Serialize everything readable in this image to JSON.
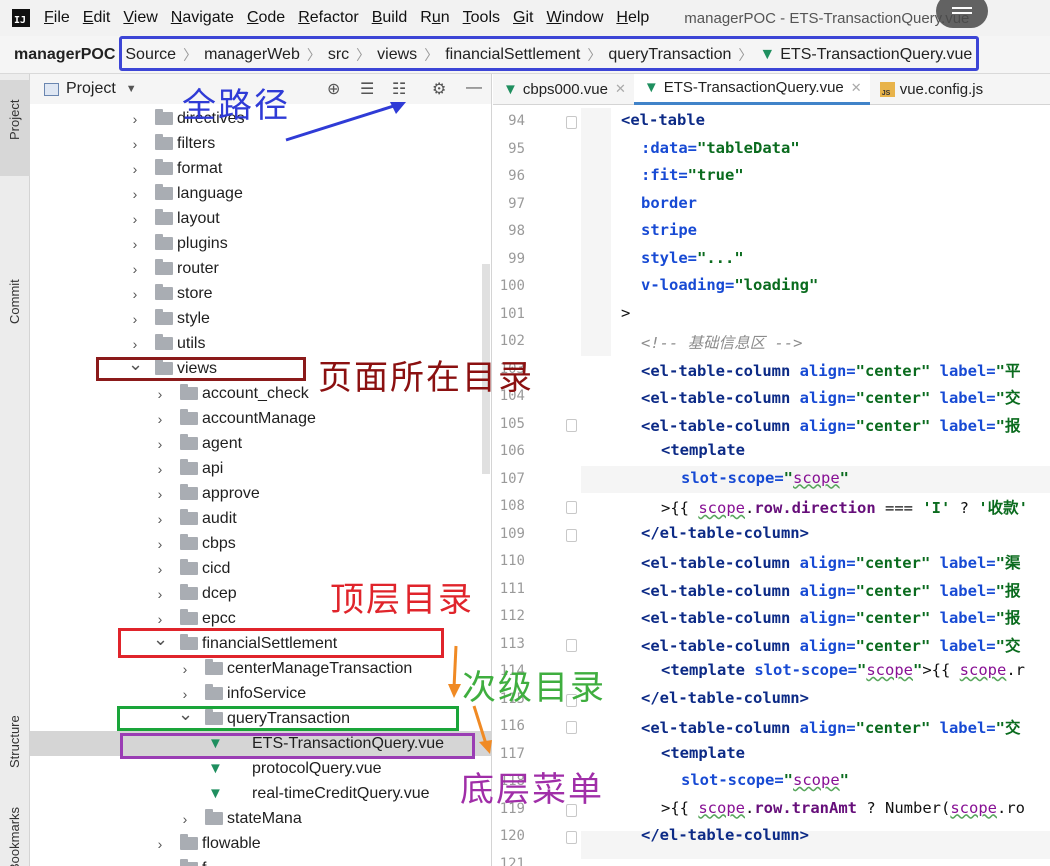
{
  "menubar": {
    "items": [
      {
        "underline": "F",
        "rest": "ile"
      },
      {
        "underline": "E",
        "rest": "dit"
      },
      {
        "underline": "V",
        "rest": "iew"
      },
      {
        "underline": "N",
        "rest": "avigate"
      },
      {
        "underline": "C",
        "rest": "ode"
      },
      {
        "underline": "R",
        "rest": "efactor"
      },
      {
        "underline": "B",
        "rest": "uild"
      },
      {
        "pre": "R",
        "underline": "u",
        "rest": "n"
      },
      {
        "underline": "T",
        "rest": "ools"
      },
      {
        "underline": "G",
        "rest": "it"
      },
      {
        "underline": "W",
        "rest": "indow"
      },
      {
        "underline": "H",
        "rest": "elp"
      }
    ],
    "window_title": "managerPOC - ETS-TransactionQuery.vue"
  },
  "navbar": {
    "project": "managerPOC",
    "crumbs": [
      "Source",
      "managerWeb",
      "src",
      "views",
      "financialSettlement",
      "queryTransaction",
      "ETS-TransactionQuery.vue"
    ]
  },
  "sidebar": {
    "project_tab": "Project",
    "commit_tab": "Commit",
    "structure_tab": "Structure",
    "bookmarks_tab": "Bookmarks"
  },
  "project_panel": {
    "header": "Project",
    "tree": [
      {
        "label": "directives",
        "level": 0,
        "type": "folder",
        "state": "collapsed"
      },
      {
        "label": "filters",
        "level": 0,
        "type": "folder",
        "state": "collapsed"
      },
      {
        "label": "format",
        "level": 0,
        "type": "folder",
        "state": "collapsed"
      },
      {
        "label": "language",
        "level": 0,
        "type": "folder",
        "state": "collapsed"
      },
      {
        "label": "layout",
        "level": 0,
        "type": "folder",
        "state": "collapsed"
      },
      {
        "label": "plugins",
        "level": 0,
        "type": "folder",
        "state": "collapsed"
      },
      {
        "label": "router",
        "level": 0,
        "type": "folder",
        "state": "collapsed"
      },
      {
        "label": "store",
        "level": 0,
        "type": "folder",
        "state": "collapsed"
      },
      {
        "label": "style",
        "level": 0,
        "type": "folder",
        "state": "collapsed"
      },
      {
        "label": "utils",
        "level": 0,
        "type": "folder",
        "state": "collapsed"
      },
      {
        "label": "views",
        "level": 0,
        "type": "folder",
        "state": "expanded"
      },
      {
        "label": "account_check",
        "level": 1,
        "type": "folder",
        "state": "collapsed"
      },
      {
        "label": "accountManage",
        "level": 1,
        "type": "folder",
        "state": "collapsed"
      },
      {
        "label": "agent",
        "level": 1,
        "type": "folder",
        "state": "collapsed"
      },
      {
        "label": "api",
        "level": 1,
        "type": "folder",
        "state": "collapsed"
      },
      {
        "label": "approve",
        "level": 1,
        "type": "folder",
        "state": "collapsed"
      },
      {
        "label": "audit",
        "level": 1,
        "type": "folder",
        "state": "collapsed"
      },
      {
        "label": "cbps",
        "level": 1,
        "type": "folder",
        "state": "collapsed"
      },
      {
        "label": "cicd",
        "level": 1,
        "type": "folder",
        "state": "collapsed"
      },
      {
        "label": "dcep",
        "level": 1,
        "type": "folder",
        "state": "collapsed"
      },
      {
        "label": "epcc",
        "level": 1,
        "type": "folder",
        "state": "collapsed"
      },
      {
        "label": "financialSettlement",
        "level": 1,
        "type": "folder",
        "state": "expanded"
      },
      {
        "label": "centerManageTransaction",
        "level": 2,
        "type": "folder",
        "state": "collapsed"
      },
      {
        "label": "infoService",
        "level": 2,
        "type": "folder",
        "state": "collapsed"
      },
      {
        "label": "queryTransaction",
        "level": 2,
        "type": "folder",
        "state": "expanded"
      },
      {
        "label": "ETS-TransactionQuery.vue",
        "level": 3,
        "type": "vue",
        "state": "selected"
      },
      {
        "label": "protocolQuery.vue",
        "level": 3,
        "type": "vue",
        "state": "none"
      },
      {
        "label": "real-timeCreditQuery.vue",
        "level": 3,
        "type": "vue",
        "state": "none"
      },
      {
        "label": "stateMana",
        "level": 2,
        "type": "folder",
        "state": "collapsed"
      },
      {
        "label": "flowable",
        "level": 1,
        "type": "folder",
        "state": "collapsed"
      },
      {
        "label": "f",
        "level": 1,
        "type": "folder",
        "state": "collapsed"
      }
    ]
  },
  "editor": {
    "tabs": [
      {
        "label": "cbps000.vue",
        "icon": "vue-icon",
        "active": false
      },
      {
        "label": "ETS-TransactionQuery.vue",
        "icon": "vue-icon",
        "active": true
      },
      {
        "label": "vue.config.js",
        "icon": "js-file-icon",
        "active": false
      }
    ],
    "lines": [
      {
        "n": "94",
        "indent": 2,
        "fold": true,
        "segs": [
          [
            "tg",
            "<el-table"
          ]
        ]
      },
      {
        "n": "95",
        "indent": 3,
        "segs": [
          [
            "at",
            ":data="
          ],
          [
            "sv",
            "\"tableData\""
          ]
        ]
      },
      {
        "n": "96",
        "indent": 3,
        "segs": [
          [
            "at",
            ":fit="
          ],
          [
            "sv",
            "\"true\""
          ]
        ]
      },
      {
        "n": "97",
        "indent": 3,
        "segs": [
          [
            "at",
            "border"
          ]
        ]
      },
      {
        "n": "98",
        "indent": 3,
        "segs": [
          [
            "at",
            "stripe"
          ]
        ]
      },
      {
        "n": "99",
        "indent": 3,
        "segs": [
          [
            "at",
            "style="
          ],
          [
            "sv",
            "\"...\""
          ]
        ]
      },
      {
        "n": "100",
        "indent": 3,
        "segs": [
          [
            "at",
            "v-loading="
          ],
          [
            "sv",
            "\"loading\""
          ]
        ]
      },
      {
        "n": "101",
        "indent": 2,
        "segs": [
          [
            "tx",
            ">"
          ]
        ]
      },
      {
        "n": "102",
        "indent": 3,
        "segs": [
          [
            "cm",
            "<!-- 基础信息区 -->"
          ]
        ]
      },
      {
        "n": "103",
        "indent": 3,
        "segs": [
          [
            "tg",
            "<el-table-column "
          ],
          [
            "at",
            "align="
          ],
          [
            "sv",
            "\"center\" "
          ],
          [
            "at",
            "label="
          ],
          [
            "sv",
            "\"平"
          ]
        ]
      },
      {
        "n": "104",
        "indent": 3,
        "segs": [
          [
            "tg",
            "<el-table-column "
          ],
          [
            "at",
            "align="
          ],
          [
            "sv",
            "\"center\" "
          ],
          [
            "at",
            "label="
          ],
          [
            "sv",
            "\"交"
          ]
        ]
      },
      {
        "n": "105",
        "indent": 3,
        "fold": true,
        "segs": [
          [
            "tg",
            "<el-table-column "
          ],
          [
            "at",
            "align="
          ],
          [
            "sv",
            "\"center\" "
          ],
          [
            "at",
            "label="
          ],
          [
            "sv",
            "\"报"
          ]
        ]
      },
      {
        "n": "106",
        "indent": 4,
        "segs": [
          [
            "tg",
            "<template"
          ]
        ]
      },
      {
        "n": "107",
        "indent": 5,
        "segs": [
          [
            "at",
            "slot-scope="
          ],
          [
            "sv",
            "\""
          ],
          [
            "sc",
            "scope"
          ],
          [
            "sv",
            "\""
          ]
        ]
      },
      {
        "n": "108",
        "indent": 4,
        "fold": true,
        "segs": [
          [
            "tx",
            ">{{ "
          ],
          [
            "sc",
            "scope"
          ],
          [
            "tx",
            "."
          ],
          [
            "pr",
            "row.direction"
          ],
          [
            "tx",
            " === "
          ],
          [
            "sv",
            "'I'"
          ],
          [
            "tx",
            " ? "
          ],
          [
            "sv",
            "'收款'"
          ]
        ]
      },
      {
        "n": "109",
        "indent": 3,
        "fold": true,
        "segs": [
          [
            "tg",
            "</el-table-column>"
          ]
        ]
      },
      {
        "n": "110",
        "indent": 3,
        "segs": [
          [
            "tg",
            "<el-table-column "
          ],
          [
            "at",
            "align="
          ],
          [
            "sv",
            "\"center\" "
          ],
          [
            "at",
            "label="
          ],
          [
            "sv",
            "\"渠"
          ]
        ]
      },
      {
        "n": "111",
        "indent": 3,
        "segs": [
          [
            "tg",
            "<el-table-column "
          ],
          [
            "at",
            "align="
          ],
          [
            "sv",
            "\"center\" "
          ],
          [
            "at",
            "label="
          ],
          [
            "sv",
            "\"报"
          ]
        ]
      },
      {
        "n": "112",
        "indent": 3,
        "segs": [
          [
            "tg",
            "<el-table-column "
          ],
          [
            "at",
            "align="
          ],
          [
            "sv",
            "\"center\" "
          ],
          [
            "at",
            "label="
          ],
          [
            "sv",
            "\"报"
          ]
        ]
      },
      {
        "n": "113",
        "indent": 3,
        "fold": true,
        "segs": [
          [
            "tg",
            "<el-table-column "
          ],
          [
            "at",
            "align="
          ],
          [
            "sv",
            "\"center\" "
          ],
          [
            "at",
            "label="
          ],
          [
            "sv",
            "\"交"
          ]
        ]
      },
      {
        "n": "114",
        "indent": 4,
        "segs": [
          [
            "tg",
            "<template "
          ],
          [
            "at",
            "slot-scope="
          ],
          [
            "sv",
            "\""
          ],
          [
            "sc",
            "scope"
          ],
          [
            "sv",
            "\""
          ],
          [
            "tx",
            ">{{ "
          ],
          [
            "sc",
            "scope"
          ],
          [
            "tx",
            ".r"
          ]
        ]
      },
      {
        "n": "115",
        "indent": 3,
        "fold": true,
        "segs": [
          [
            "tg",
            "</el-table-column>"
          ]
        ]
      },
      {
        "n": "116",
        "indent": 3,
        "fold": true,
        "segs": [
          [
            "tg",
            "<el-table-column "
          ],
          [
            "at",
            "align="
          ],
          [
            "sv",
            "\"center\" "
          ],
          [
            "at",
            "label="
          ],
          [
            "sv",
            "\"交"
          ]
        ]
      },
      {
        "n": "117",
        "indent": 4,
        "segs": [
          [
            "tg",
            "<template"
          ]
        ]
      },
      {
        "n": "118",
        "indent": 5,
        "segs": [
          [
            "at",
            "slot-scope="
          ],
          [
            "sv",
            "\""
          ],
          [
            "sc",
            "scope"
          ],
          [
            "sv",
            "\""
          ]
        ]
      },
      {
        "n": "119",
        "indent": 4,
        "fold": true,
        "segs": [
          [
            "tx",
            ">{{ "
          ],
          [
            "sc",
            "scope"
          ],
          [
            "tx",
            "."
          ],
          [
            "pr",
            "row.tranAmt"
          ],
          [
            "tx",
            " ? Number("
          ],
          [
            "sc",
            "scope"
          ],
          [
            "tx",
            ".ro"
          ]
        ]
      },
      {
        "n": "120",
        "indent": 3,
        "fold": true,
        "segs": [
          [
            "tg",
            "</el-table-column>"
          ]
        ]
      },
      {
        "n": "121",
        "indent": 0,
        "segs": []
      }
    ]
  },
  "annotations": {
    "full_path": "全路径",
    "page_dir": "页面所在目录",
    "top_dir": "顶层目录",
    "sub_dir": "次级目录",
    "bottom_menu": "底层菜单"
  },
  "colors": {
    "path_box": "#3c45d6",
    "views_box": "#8b1a1a",
    "top_dir_box": "#e0242b",
    "sub_dir_box": "#1aa53a",
    "bottom_box": "#9a3db4",
    "anno_blue": "#2f3bd6",
    "anno_darkred": "#8b1010",
    "anno_red": "#e0242b",
    "anno_green": "#3fae3f",
    "anno_purple": "#a02ea8",
    "arrow_orange": "#f08a24"
  }
}
